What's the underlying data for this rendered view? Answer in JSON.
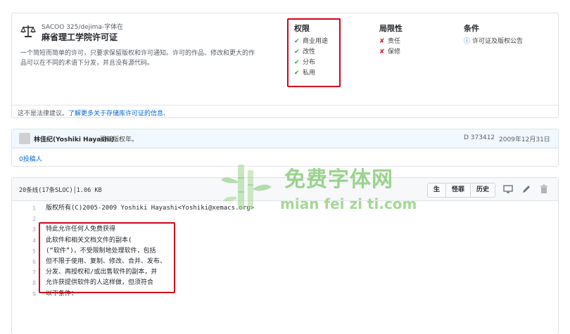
{
  "license": {
    "path": "SACOO 325/dejima-字体在",
    "title": "麻省理工学院许可证",
    "description_line1": "一个简短而简单的许可，只要求保留版权和许可通知。许可的作品、修改和更大的作",
    "description_line2": "品可以在不同的术语下分发，并且没有源代码。",
    "permissions_heading": "权限",
    "permissions": [
      "商业用途",
      "改性",
      "分布",
      "私用"
    ],
    "limitations_heading": "局限性",
    "limitations": [
      "责任",
      "保修"
    ],
    "conditions_heading": "条件",
    "conditions": [
      "许可证及版权公告"
    ],
    "footer_text": "这不是法律建议。",
    "footer_link": "了解更多关于存储库许可证的信息."
  },
  "commit": {
    "author": "林佳纪(Yoshiki Hayashi)",
    "message": "更新版权年。",
    "hash": "D 373412",
    "date": "2009年12月31日",
    "contributors": "0投稿人"
  },
  "file": {
    "info": "20条线(17条SLOC)│1.06 KB",
    "buttons": [
      "生",
      "怪罪",
      "历史"
    ],
    "icons": [
      "desktop-icon",
      "pencil-icon",
      "trash-icon"
    ],
    "lines": [
      {
        "num": "1",
        "text": "版权所有(C)2005-2009 Yoshiki Hayashi<Yoshiki@xemacs.org>"
      },
      {
        "num": "2",
        "text": ""
      },
      {
        "num": "3",
        "text": "特此允许任何人免费获得"
      },
      {
        "num": "4",
        "text": "此软件和相关文档文件的副本("
      },
      {
        "num": "5",
        "text": "(“软件”)，不受限制地处理软件，包括"
      },
      {
        "num": "6",
        "text": "但不限于使用、复制、修改、合并、发布、"
      },
      {
        "num": "7",
        "text": "分发、再授权和/或出售软件的副本，并"
      },
      {
        "num": "8",
        "text": "允许获提供软件的人这样做，但须符合"
      },
      {
        "num": "9",
        "text": "以下条件："
      }
    ]
  },
  "watermark": {
    "cn": "免费字体网",
    "en": "mian fei zi ti.com"
  },
  "colors": {
    "highlight_frame": "#d0021b",
    "check": "#28a745",
    "cross": "#cb2431",
    "link": "#0366d6",
    "watermark": "#7cc66b"
  }
}
